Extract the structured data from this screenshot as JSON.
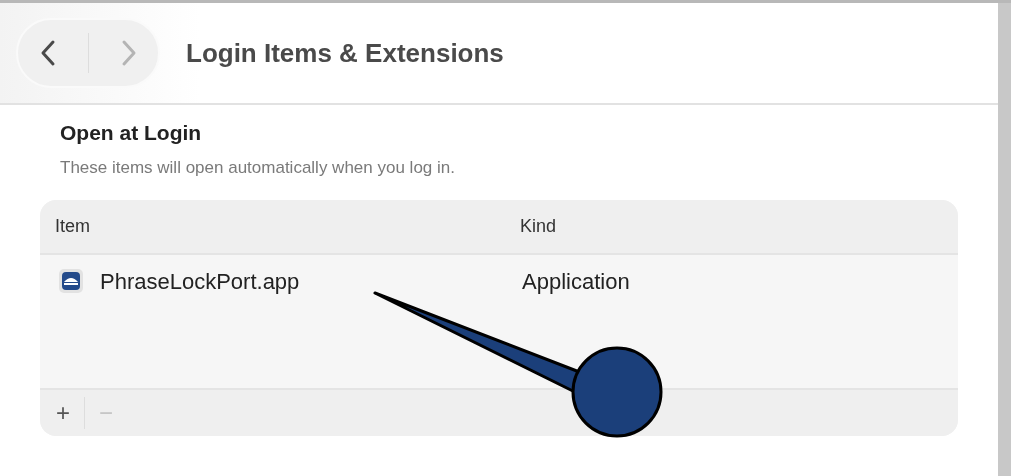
{
  "window": {
    "title": "Login Items & Extensions"
  },
  "navigation": [
    {
      "kind": "back",
      "disabled": false
    },
    {
      "kind": "forward",
      "disabled": true
    }
  ],
  "section": {
    "title": "Open at Login",
    "description": "These items will open automatically when you log in."
  },
  "table": {
    "columns": [
      "Item",
      "Kind"
    ],
    "rows": [
      {
        "item": "PhraseLockPort.app",
        "kind": "Application"
      }
    ]
  },
  "footer_buttons": [
    {
      "label": "+",
      "disabled": false
    },
    {
      "label": "−",
      "disabled": true
    }
  ]
}
